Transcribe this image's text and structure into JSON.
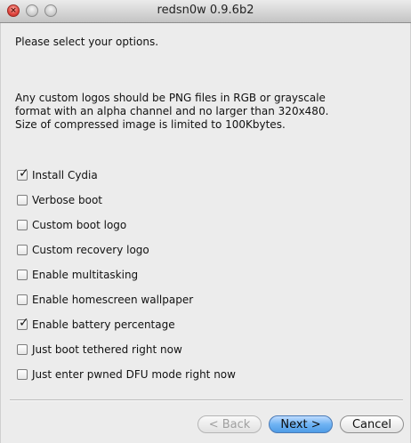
{
  "window": {
    "title": "redsn0w 0.9.6b2"
  },
  "content": {
    "prompt": "Please select your options.",
    "info_lines": [
      "Any custom logos should be PNG files in RGB or grayscale",
      "format with an alpha channel and no larger than 320x480.",
      "Size of compressed image is limited to 100Kbytes."
    ]
  },
  "options": [
    {
      "label": "Install Cydia",
      "checked": true
    },
    {
      "label": "Verbose boot",
      "checked": false
    },
    {
      "label": "Custom boot logo",
      "checked": false
    },
    {
      "label": "Custom recovery logo",
      "checked": false
    },
    {
      "label": "Enable multitasking",
      "checked": false
    },
    {
      "label": "Enable homescreen wallpaper",
      "checked": false
    },
    {
      "label": "Enable battery percentage",
      "checked": true
    },
    {
      "label": "Just boot tethered right now",
      "checked": false
    },
    {
      "label": "Just enter pwned DFU mode right now",
      "checked": false
    }
  ],
  "buttons": {
    "back": "< Back",
    "next": "Next >",
    "cancel": "Cancel"
  },
  "colors": {
    "window_bg": "#ececec",
    "default_button": "#6fb3f3",
    "close_button": "#e0443e"
  }
}
